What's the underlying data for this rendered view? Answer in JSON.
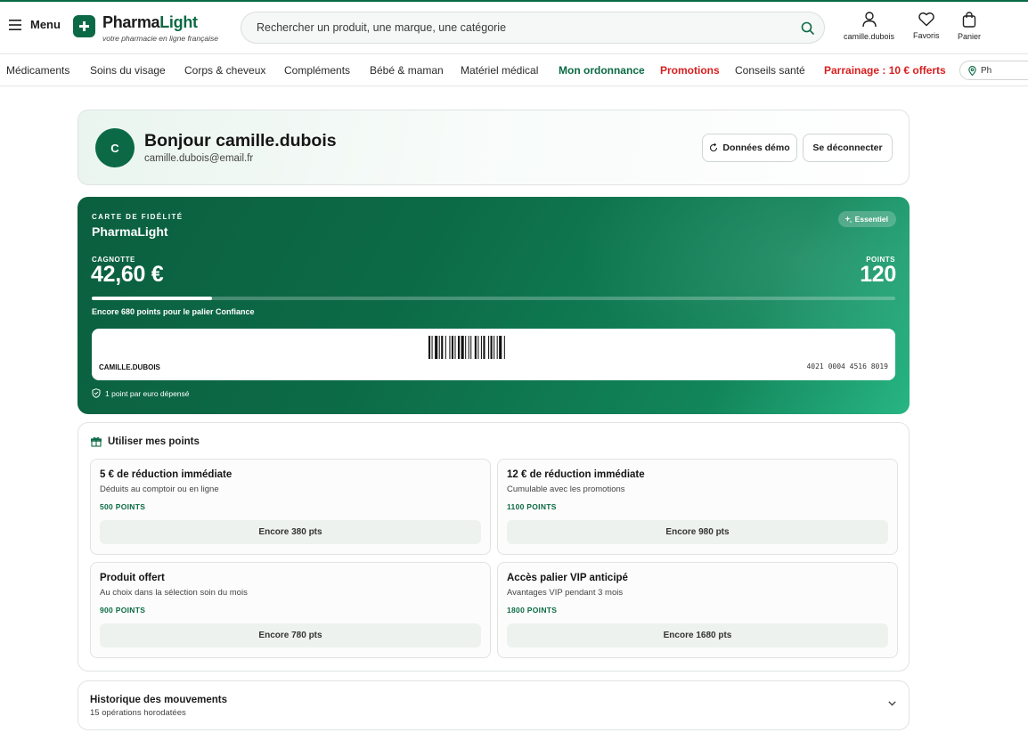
{
  "header": {
    "menu_label": "Menu",
    "logo_part1": "Pharma",
    "logo_part2": "Light",
    "logo_tagline": "votre pharmacie en ligne française",
    "search_placeholder": "Rechercher un produit, une marque, une catégorie",
    "account_label": "camille.dubois",
    "favorites_label": "Favoris",
    "cart_label": "Panier"
  },
  "nav": {
    "items": [
      {
        "label": "Médicaments"
      },
      {
        "label": "Soins du visage"
      },
      {
        "label": "Corps & cheveux"
      },
      {
        "label": "Compléments"
      },
      {
        "label": "Bébé & maman"
      },
      {
        "label": "Matériel médical"
      },
      {
        "label": "Mon ordonnance"
      },
      {
        "label": "Promotions"
      },
      {
        "label": "Conseils santé"
      },
      {
        "label": "Parrainage : 10 € offerts"
      }
    ],
    "pharmacy_pill": "Ph"
  },
  "greeting": {
    "avatar_initial": "C",
    "title": "Bonjour camille.dubois",
    "email": "camille.dubois@email.fr",
    "demo_button": "Données démo",
    "logout_button": "Se déconnecter"
  },
  "loyalty": {
    "kicker": "CARTE DE FIDÉLITÉ",
    "brand": "PharmaLight",
    "tier": "Essentiel",
    "cagnotte_label": "CAGNOTTE",
    "cagnotte_value": "42,60 €",
    "points_label": "POINTS",
    "points_value": "120",
    "progress_fraction": 0.15,
    "progress_text": "Encore 680 points pour le palier Confiance",
    "card_name": "CAMILLE.DUBOIS",
    "card_number": "4021 0004 4516 8019",
    "earn_rule": "1 point par euro dépensé"
  },
  "rewards": {
    "title": "Utiliser mes points",
    "items": [
      {
        "title": "5 € de réduction immédiate",
        "desc": "Déduits au comptoir ou en ligne",
        "points": "500 POINTS",
        "button": "Encore 380 pts"
      },
      {
        "title": "12 € de réduction immédiate",
        "desc": "Cumulable avec les promotions",
        "points": "1100 POINTS",
        "button": "Encore 980 pts"
      },
      {
        "title": "Produit offert",
        "desc": "Au choix dans la sélection soin du mois",
        "points": "900 POINTS",
        "button": "Encore 780 pts"
      },
      {
        "title": "Accès palier VIP anticipé",
        "desc": "Avantages VIP pendant 3 mois",
        "points": "1800 POINTS",
        "button": "Encore 1680 pts"
      }
    ]
  },
  "history": {
    "title": "Historique des mouvements",
    "subtitle": "15 opérations horodatées"
  },
  "colors": {
    "brand_green": "#0b6a45",
    "promo_red": "#d81f1f",
    "card_gradient_end": "#28b584"
  }
}
